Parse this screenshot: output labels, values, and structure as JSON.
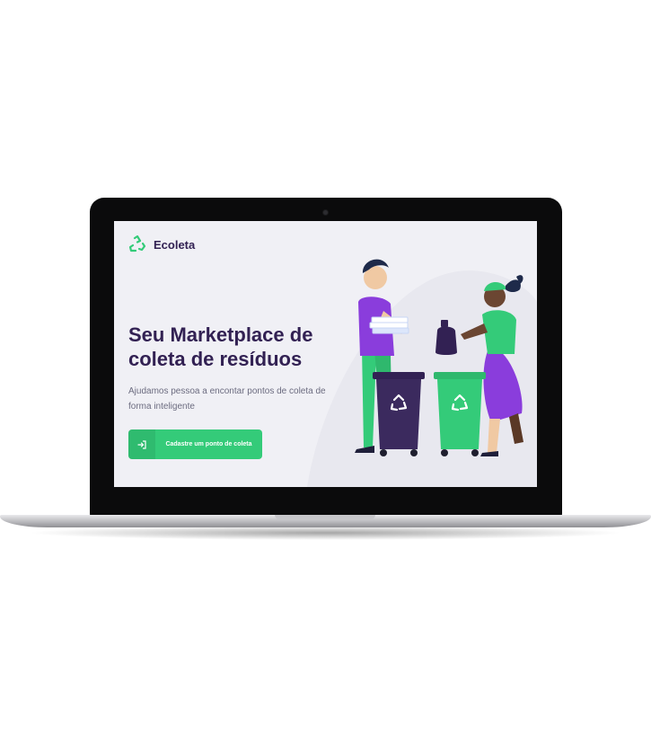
{
  "app": {
    "name": "Ecoleta"
  },
  "hero": {
    "title_line1": "Seu Marketplace de",
    "title_line2": "coleta de resíduos",
    "description": "Ajudamos pessoa a encontar pontos de coleta de forma inteligente"
  },
  "cta": {
    "label": "Cadastre um ponto de coleta",
    "icon": "log-in-icon"
  },
  "icons": {
    "logo": "recycle-icon",
    "bin": "recycle-symbol-icon"
  },
  "colors": {
    "primary": "#34cb79",
    "title": "#322153",
    "text": "#6c6c80",
    "background": "#f0f0f5",
    "purple": "#8a3ddc"
  }
}
